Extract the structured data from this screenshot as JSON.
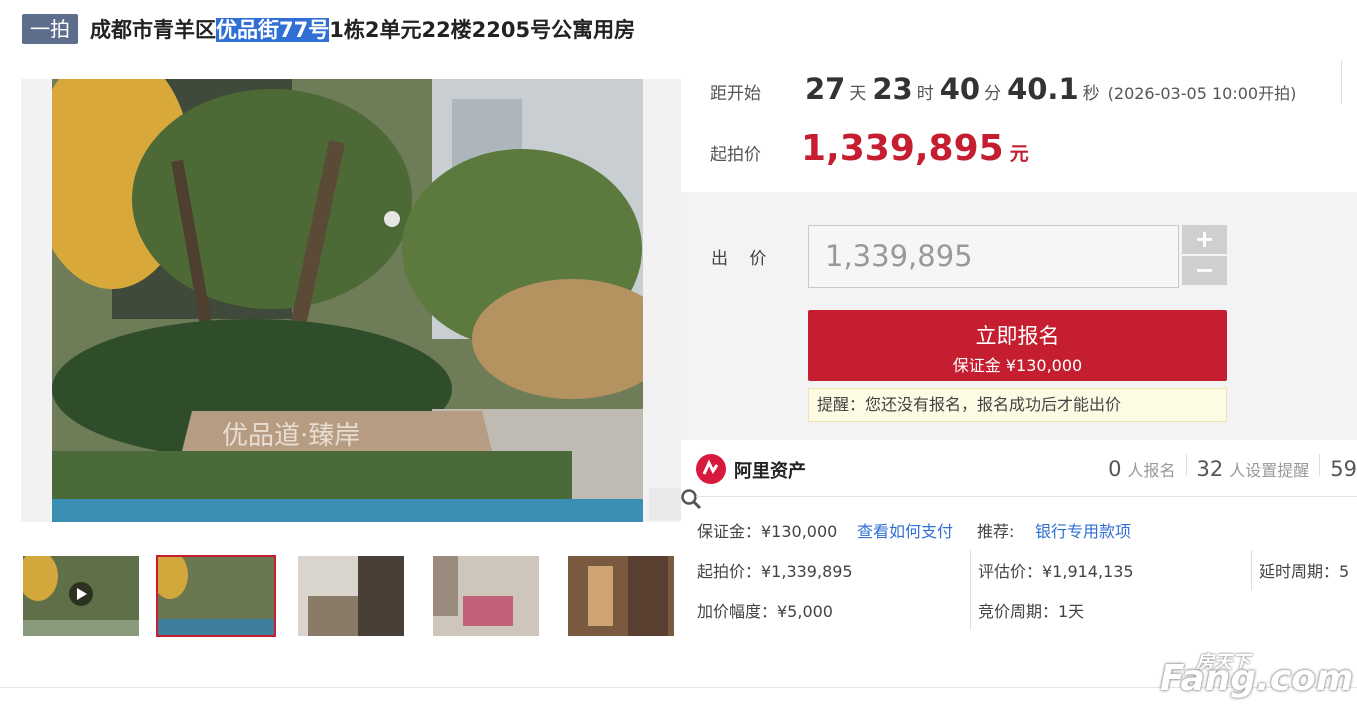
{
  "header": {
    "badge": "一拍",
    "title_prefix": "成都市青羊区",
    "title_highlight": "优品街77号",
    "title_suffix": "1栋2单元22楼2205号公寓用房"
  },
  "countdown": {
    "label": "距开始",
    "days": "27",
    "days_unit": "天",
    "hours": "23",
    "hours_unit": "时",
    "minutes": "40",
    "minutes_unit": "分",
    "seconds": "40.1",
    "seconds_unit": "秒",
    "start_date": "(2026-03-05 10:00开拍)"
  },
  "price": {
    "label": "起拍价",
    "value": "1,339,895",
    "unit": "元"
  },
  "bid": {
    "label": "出 价",
    "input_value": "1,339,895",
    "plus": "+",
    "minus": "−",
    "signup_label": "立即报名",
    "deposit_label": "保证金 ¥130,000",
    "tip": "提醒：您还没有报名，报名成功后才能出价"
  },
  "platform": {
    "name": "阿里资产",
    "signups_count": "0",
    "signups_label": "人报名",
    "reminders_count": "32",
    "reminders_label": "人设置提醒",
    "views_count": "59"
  },
  "details": {
    "deposit": "保证金：¥130,000",
    "how_to_pay": "查看如何支付",
    "recommend_label": "推荐:",
    "recommend_link": "银行专用款项",
    "start_price": "起拍价：¥1,339,895",
    "appraisal": "评估价：¥1,914,135",
    "extension": "延时周期：5",
    "increment": "加价幅度：¥5,000",
    "bid_period": "竞价周期：1天"
  },
  "watermark": {
    "top": "房天下",
    "brand": "Fang.com"
  },
  "colors": {
    "accent": "#c41e30",
    "link": "#2f6fd6",
    "badge": "#5d6e8c"
  }
}
